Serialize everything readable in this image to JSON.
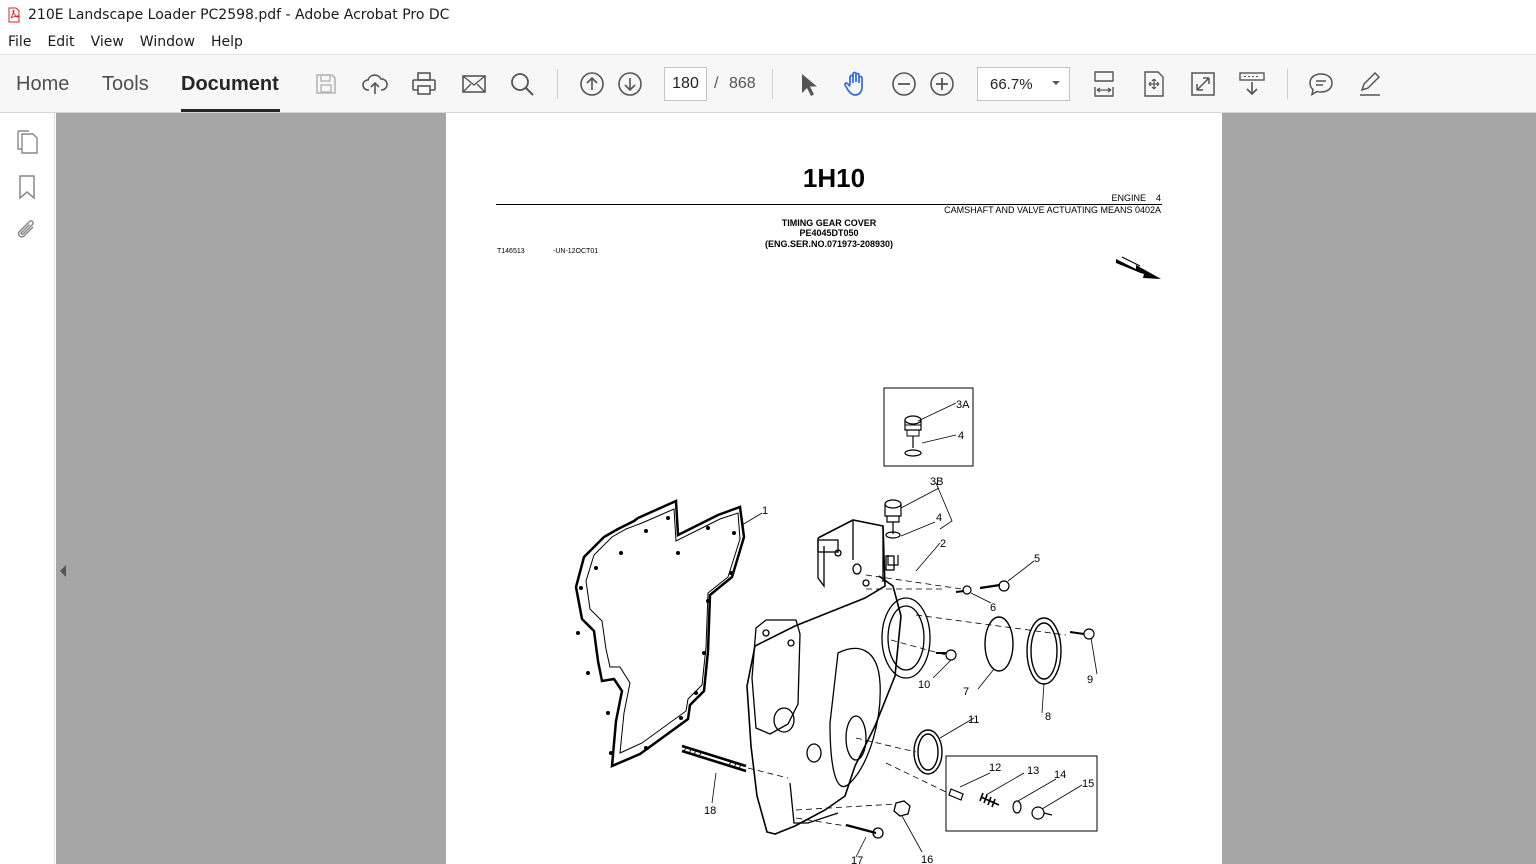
{
  "window": {
    "title": "210E Landscape Loader PC2598.pdf - Adobe Acrobat Pro DC"
  },
  "menu": [
    "File",
    "Edit",
    "View",
    "Window",
    "Help"
  ],
  "tabs": {
    "home": "Home",
    "tools": "Tools",
    "document": "Document"
  },
  "navigation": {
    "current_page": "180",
    "separator": "/",
    "total_pages": "868"
  },
  "zoom": {
    "value": "66.7%"
  },
  "icons": {
    "toolbar": [
      "save-icon",
      "upload-cloud-icon",
      "print-icon",
      "email-icon",
      "search-icon",
      "prev-page-icon",
      "next-page-icon",
      "select-cursor-icon",
      "hand-icon",
      "zoom-out-icon",
      "zoom-in-icon",
      "fit-width-icon",
      "fit-page-icon",
      "full-screen-icon",
      "scroll-mode-icon",
      "comment-icon",
      "sign-icon"
    ],
    "sidebar": [
      "page-thumbnails-icon",
      "bookmarks-icon",
      "attachments-icon"
    ]
  },
  "colors": {
    "accent_blue": "#2d6cdf",
    "viewer_bg": "#a6a6a6",
    "toolbar_bg": "#f7f7f7",
    "pdf_red": "#d6261c"
  },
  "document": {
    "page_title": "1H10",
    "engine_label": "ENGINE    4",
    "camshaft_label": "CAMSHAFT AND VALVE ACTUATING MEANS  0402A",
    "heading_line1": "TIMING GEAR COVER",
    "heading_line2": "PE4045DT050",
    "heading_line3": "(ENG.SER.NO.071973-208930)",
    "figure_code": "T146513",
    "figure_date": "-UN-12OCT01",
    "callouts": {
      "c1": "1",
      "c2": "2",
      "c3a": "3A",
      "c3b": "3B",
      "c4a": "4",
      "c4b": "4",
      "c5": "5",
      "c6": "6",
      "c7": "7",
      "c8": "8",
      "c9": "9",
      "c10": "10",
      "c11": "11",
      "c12": "12",
      "c13": "13",
      "c14": "14",
      "c15": "15",
      "c16": "16",
      "c17": "17",
      "c18": "18"
    }
  }
}
